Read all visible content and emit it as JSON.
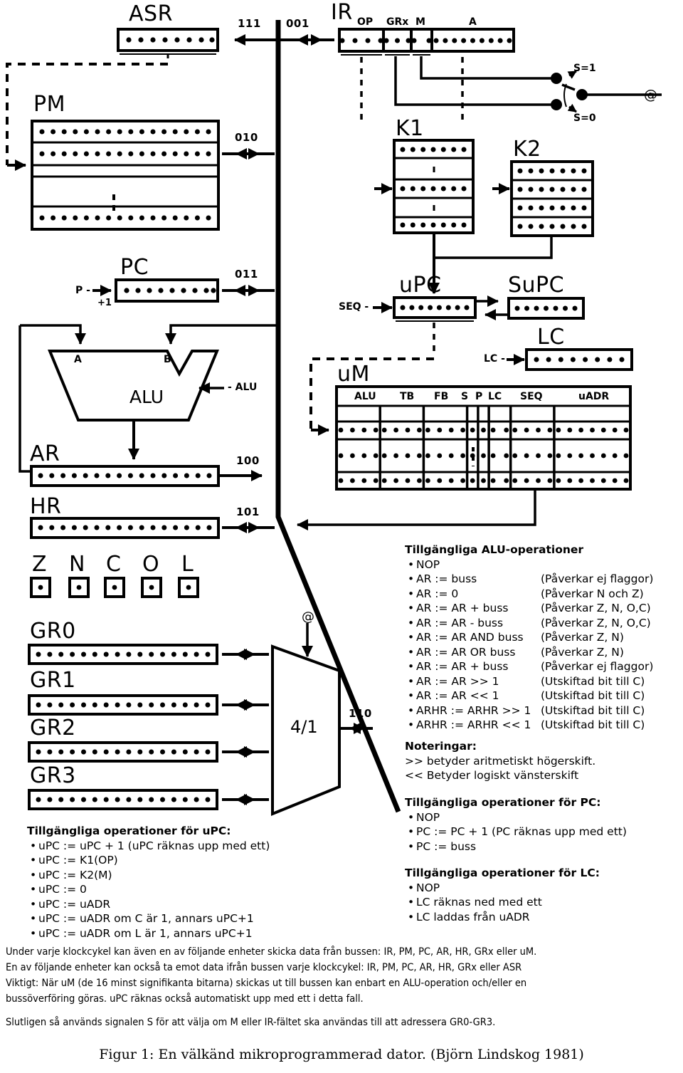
{
  "figure": {
    "caption": "Figur 1: En välkänd mikroprogrammerad dator. (Björn Lindskog 1981)"
  },
  "registers": {
    "asr": {
      "label": "ASR",
      "bits": 8,
      "bus_code": "111"
    },
    "pm": {
      "label": "PM",
      "bits": 16,
      "bus_code": "010"
    },
    "pc": {
      "label": "PC",
      "bits": 9,
      "bus_code": "011",
      "ctrl": "P -",
      "inc": "+1"
    },
    "ir": {
      "label": "IR",
      "bus_code": "001",
      "fields": [
        {
          "name": "OP",
          "bits": 4
        },
        {
          "name": "GRx",
          "bits": 3
        },
        {
          "name": "M",
          "bits": 2
        },
        {
          "name": "A",
          "bits": 9
        }
      ]
    },
    "ar": {
      "label": "AR",
      "bits": 16,
      "bus_code": "100"
    },
    "hr": {
      "label": "HR",
      "bits": 16,
      "bus_code": "101"
    },
    "k1": {
      "label": "K1",
      "bits": 7
    },
    "k2": {
      "label": "K2",
      "bits": 7
    },
    "upc": {
      "label": "uPC",
      "bits": 8,
      "ctrl": "SEQ -"
    },
    "supc": {
      "label": "SuPC",
      "bits": 7
    },
    "lc": {
      "label": "LC",
      "bits": 8,
      "ctrl": "LC -"
    },
    "um": {
      "label": "uM",
      "fields": [
        {
          "name": "ALU",
          "bits": 4
        },
        {
          "name": "TB",
          "bits": 4
        },
        {
          "name": "FB",
          "bits": 4
        },
        {
          "name": "S",
          "bits": 1
        },
        {
          "name": "P",
          "bits": 1
        },
        {
          "name": "LC",
          "bits": 2
        },
        {
          "name": "SEQ",
          "bits": 4
        },
        {
          "name": "uADR",
          "bits": 7
        }
      ]
    },
    "alu": {
      "label": "ALU",
      "input_a": "A",
      "input_b": "B",
      "ctrl": "- ALU"
    },
    "mux": {
      "label": "4/1",
      "bus_code": "110",
      "select": "@"
    },
    "gr": [
      {
        "label": "GR0",
        "bits": 16
      },
      {
        "label": "GR1",
        "bits": 16
      },
      {
        "label": "GR2",
        "bits": 16
      },
      {
        "label": "GR3",
        "bits": 16
      }
    ]
  },
  "flags": [
    {
      "label": "Z"
    },
    {
      "label": "N"
    },
    {
      "label": "C"
    },
    {
      "label": "O"
    },
    {
      "label": "L"
    }
  ],
  "switch": {
    "on_label": "S=1",
    "off_label": "S=0",
    "output_label": "@"
  },
  "alu_ops": {
    "title": "Tillgängliga ALU-operationer",
    "items": [
      {
        "op": "NOP",
        "note": ""
      },
      {
        "op": "AR := buss",
        "note": "(Påverkar ej flaggor)"
      },
      {
        "op": "AR := 0",
        "note": "(Påverkar N och Z)"
      },
      {
        "op": "AR := AR + buss",
        "note": "(Påverkar Z, N, O,C)"
      },
      {
        "op": "AR := AR - buss",
        "note": "(Påverkar Z, N, O,C)"
      },
      {
        "op": "AR := AR AND buss",
        "note": "(Påverkar Z, N)"
      },
      {
        "op": "AR := AR OR buss",
        "note": "(Påverkar Z, N)"
      },
      {
        "op": "AR := AR + buss",
        "note": "(Påverkar ej flaggor)"
      },
      {
        "op": "AR := AR >> 1",
        "note": "(Utskiftad bit till C)"
      },
      {
        "op": "AR := AR << 1",
        "note": "(Utskiftad bit till C)"
      },
      {
        "op": "ARHR := ARHR >> 1",
        "note": "(Utskiftad bit till C)"
      },
      {
        "op": "ARHR := ARHR << 1",
        "note": "(Utskiftad bit till C)"
      }
    ]
  },
  "notes": {
    "title": "Noteringar:",
    "lines": [
      ">> betyder aritmetiskt högerskift.",
      "<< Betyder logiskt vänsterskift"
    ]
  },
  "pc_ops": {
    "title": "Tillgängliga operationer för PC:",
    "items": [
      "NOP",
      "PC := PC + 1   (PC räknas upp med ett)",
      "PC := buss"
    ]
  },
  "lc_ops": {
    "title": "Tillgängliga operationer för LC:",
    "items": [
      "NOP",
      "LC räknas ned med ett",
      "LC laddas från uADR"
    ]
  },
  "upc_ops": {
    "title": "Tillgängliga operationer för uPC:",
    "items": [
      "uPC := uPC + 1 (uPC räknas upp med ett)",
      "uPC := K1(OP)",
      "uPC := K2(M)",
      "uPC := 0",
      "uPC := uADR",
      "uPC := uADR om C är 1, annars uPC+1",
      "uPC := uADR om L är 1, annars uPC+1"
    ]
  },
  "paragraphs": [
    "Under varje klockcykel kan även en av följande enheter skicka data från bussen: IR, PM, PC, AR, HR, GRx eller uM.",
    "En av följande enheter kan också ta emot data ifrån bussen varje klockcykel: IR, PM, PC, AR, HR, GRx eller ASR",
    "Viktigt: När uM (de 16 minst signifikanta bitarna) skickas ut till bussen kan enbart en ALU-operation och/eller en",
    "bussöverföring göras. uPC räknas också automatiskt upp med ett i detta fall."
  ],
  "final_paragraph": "Slutligen så används signalen S för att välja om M eller IR-fältet ska användas till att adressera GR0-GR3.",
  "colors": {
    "ink": "#000000",
    "paper": "#ffffff"
  }
}
